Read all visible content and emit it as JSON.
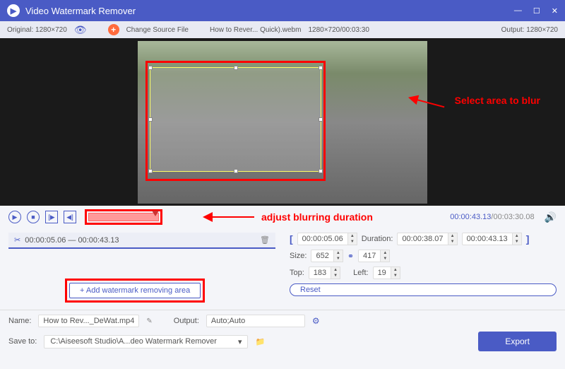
{
  "titlebar": {
    "title": "Video Watermark Remover"
  },
  "topbar": {
    "original": "Original: 1280×720",
    "change_source": "Change Source File",
    "filename": "How to Rever... Quick).webm",
    "resolution_duration": "1280×720/00:03:30",
    "output": "Output: 1280×720"
  },
  "annotations": {
    "select_area": "Select area to blur",
    "adjust_duration": "adjust blurring duration"
  },
  "time": {
    "current": "00:00:43.13",
    "total": "/00:03:30.08"
  },
  "range_item": {
    "text": "00:00:05.06 — 00:00:43.13"
  },
  "duration_props": {
    "start": "00:00:05.06",
    "duration_label": "Duration:",
    "duration": "00:00:38.07",
    "end": "00:00:43.13"
  },
  "size_props": {
    "label": "Size:",
    "w": "652",
    "h": "417"
  },
  "pos_props": {
    "top_label": "Top:",
    "top": "183",
    "left_label": "Left:",
    "left": "19"
  },
  "buttons": {
    "add_area": "+  Add watermark removing area",
    "reset": "Reset",
    "export": "Export"
  },
  "bottom": {
    "name_label": "Name:",
    "name_value": "How to Rev..._DeWat.mp4",
    "output_label": "Output:",
    "output_value": "Auto;Auto",
    "save_label": "Save to:",
    "save_value": "C:\\Aiseesoft Studio\\A...deo Watermark Remover"
  }
}
